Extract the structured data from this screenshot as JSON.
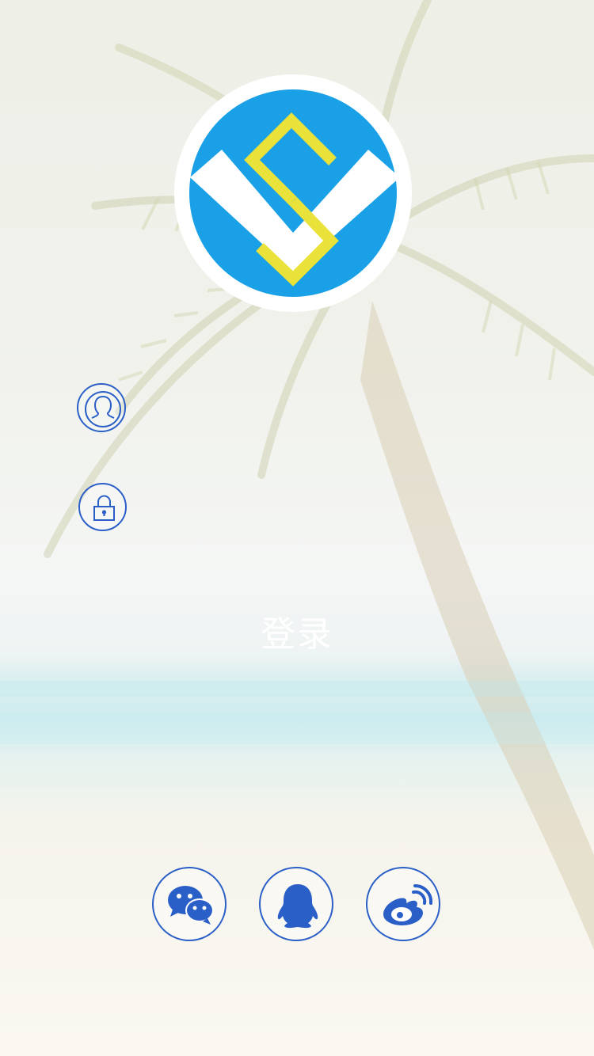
{
  "login": {
    "username_placeholder": "",
    "password_placeholder": "",
    "button_label": "登录"
  },
  "social_logins": [
    {
      "name": "wechat",
      "icon": "wechat-icon"
    },
    {
      "name": "qq",
      "icon": "qq-icon"
    },
    {
      "name": "weibo",
      "icon": "weibo-icon"
    }
  ],
  "colors": {
    "accent": "#2b5fc8",
    "logo_blue": "#1aa0e6",
    "logo_yellow": "#e8e23a",
    "logo_white": "#ffffff"
  }
}
